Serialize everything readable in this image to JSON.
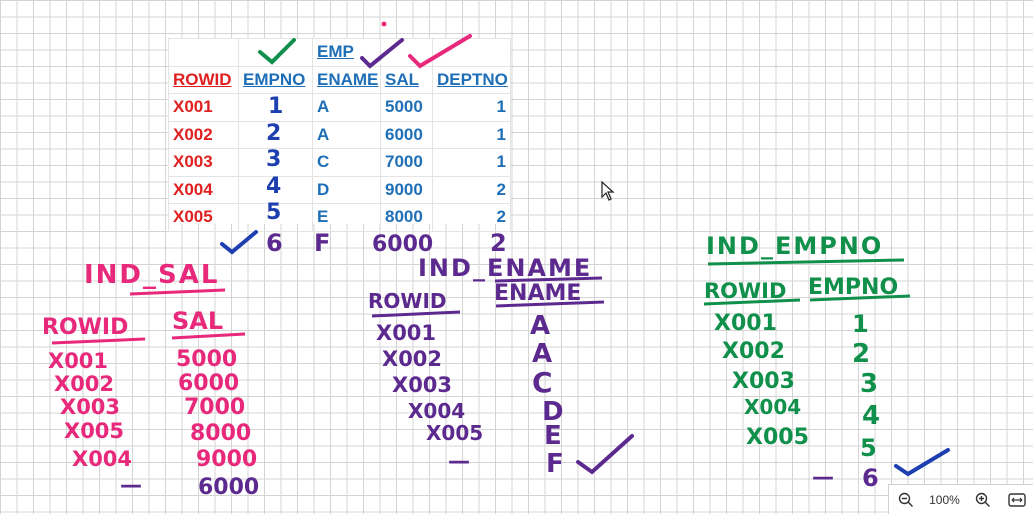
{
  "table": {
    "title": "EMP",
    "headers": [
      "ROWID",
      "EMPNO",
      "ENAME",
      "SAL",
      "DEPTNO"
    ],
    "rows": [
      [
        "X001",
        "1",
        "A",
        "5000",
        "1"
      ],
      [
        "X002",
        "2",
        "A",
        "6000",
        "1"
      ],
      [
        "X003",
        "3",
        "C",
        "7000",
        "1"
      ],
      [
        "X004",
        "4",
        "D",
        "9000",
        "2"
      ],
      [
        "X005",
        "5",
        "E",
        "8000",
        "2"
      ]
    ]
  },
  "new_row": {
    "empno": "6",
    "ename": "F",
    "sal": "6000",
    "deptno": "2"
  },
  "ind_sal": {
    "title": "IND_SAL",
    "col1": "ROWID",
    "col2": "SAL",
    "rowids": [
      "X001",
      "X002",
      "X003",
      "X005",
      "X004",
      "—"
    ],
    "values": [
      "5000",
      "6000",
      "7000",
      "8000",
      "9000",
      "6000"
    ]
  },
  "ind_ename": {
    "title": "IND_ENAME",
    "col1": "ROWID",
    "col2": "ENAME",
    "rowids": [
      "X001",
      "X002",
      "X003",
      "X004",
      "X005",
      "—"
    ],
    "values": [
      "A",
      "A",
      "C",
      "D",
      "E",
      "F"
    ]
  },
  "ind_empno": {
    "title": "IND_EMPNO",
    "col1": "ROWID",
    "col2": "EMPNO",
    "rowids": [
      "X001",
      "X002",
      "X003",
      "X004",
      "X005",
      "—"
    ],
    "values": [
      "1",
      "2",
      "3",
      "4",
      "5",
      "6"
    ]
  },
  "zoom": {
    "level": "100%"
  },
  "colors": {
    "pink": "#e8287a",
    "purple": "#5c2a8e",
    "green": "#10904a",
    "blue": "#1d3fb0",
    "rowid_red": "#e02020",
    "header_blue": "#1e6fb8"
  },
  "icons": [
    "zoom-out-icon",
    "zoom-in-icon",
    "fit-to-screen-icon",
    "pointer-cursor-icon",
    "checkmark-icon"
  ]
}
